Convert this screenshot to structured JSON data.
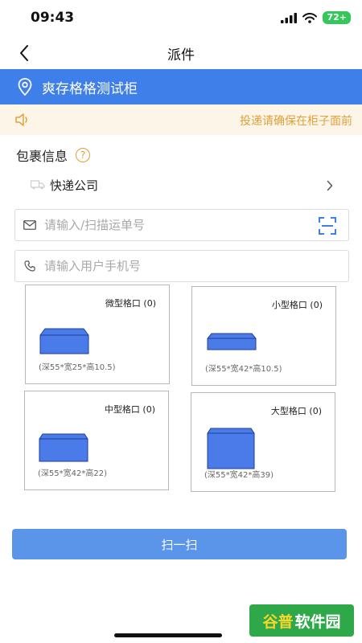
{
  "status_bar": {
    "time": "09:43",
    "battery": "72+"
  },
  "nav": {
    "title": "派件"
  },
  "location": {
    "name": "爽存格格测试柜"
  },
  "notice": {
    "text": "投递请确保在柜子面前"
  },
  "parcel_section": {
    "title": "包裹信息",
    "help": "?"
  },
  "courier": {
    "label": "快递公司"
  },
  "tracking": {
    "placeholder": "请输入/扫描运单号",
    "value": ""
  },
  "phone": {
    "placeholder": "请输入用户手机号",
    "value": ""
  },
  "slots": [
    {
      "name": "微型格口 (0)",
      "dims": "(深55*宽25*高10.5)"
    },
    {
      "name": "小型格口 (0)",
      "dims": "(深55*宽42*高10.5)"
    },
    {
      "name": "中型格口 (0)",
      "dims": "(深55*宽42*高22)"
    },
    {
      "name": "大型格口 (0)",
      "dims": "(深55*宽42*高39)"
    }
  ],
  "scan_button": {
    "label": "扫一扫"
  },
  "watermark": {
    "part1": "谷普",
    "part2": "软件园"
  },
  "colors": {
    "primary": "#3f7fe9",
    "button": "#5a95ea",
    "notice_text": "#e0a03a",
    "notice_bg": "#fdf6e8",
    "box_fill": "#4a7be8"
  },
  "icons": {
    "back": "chevron-left-icon",
    "location": "location-pin-icon",
    "notice": "speaker-icon",
    "help": "question-circle-icon",
    "courier": "truck-icon",
    "tracking": "mail-icon",
    "scan": "scan-icon",
    "phone": "phone-icon",
    "more": "chevron-right-icon"
  }
}
